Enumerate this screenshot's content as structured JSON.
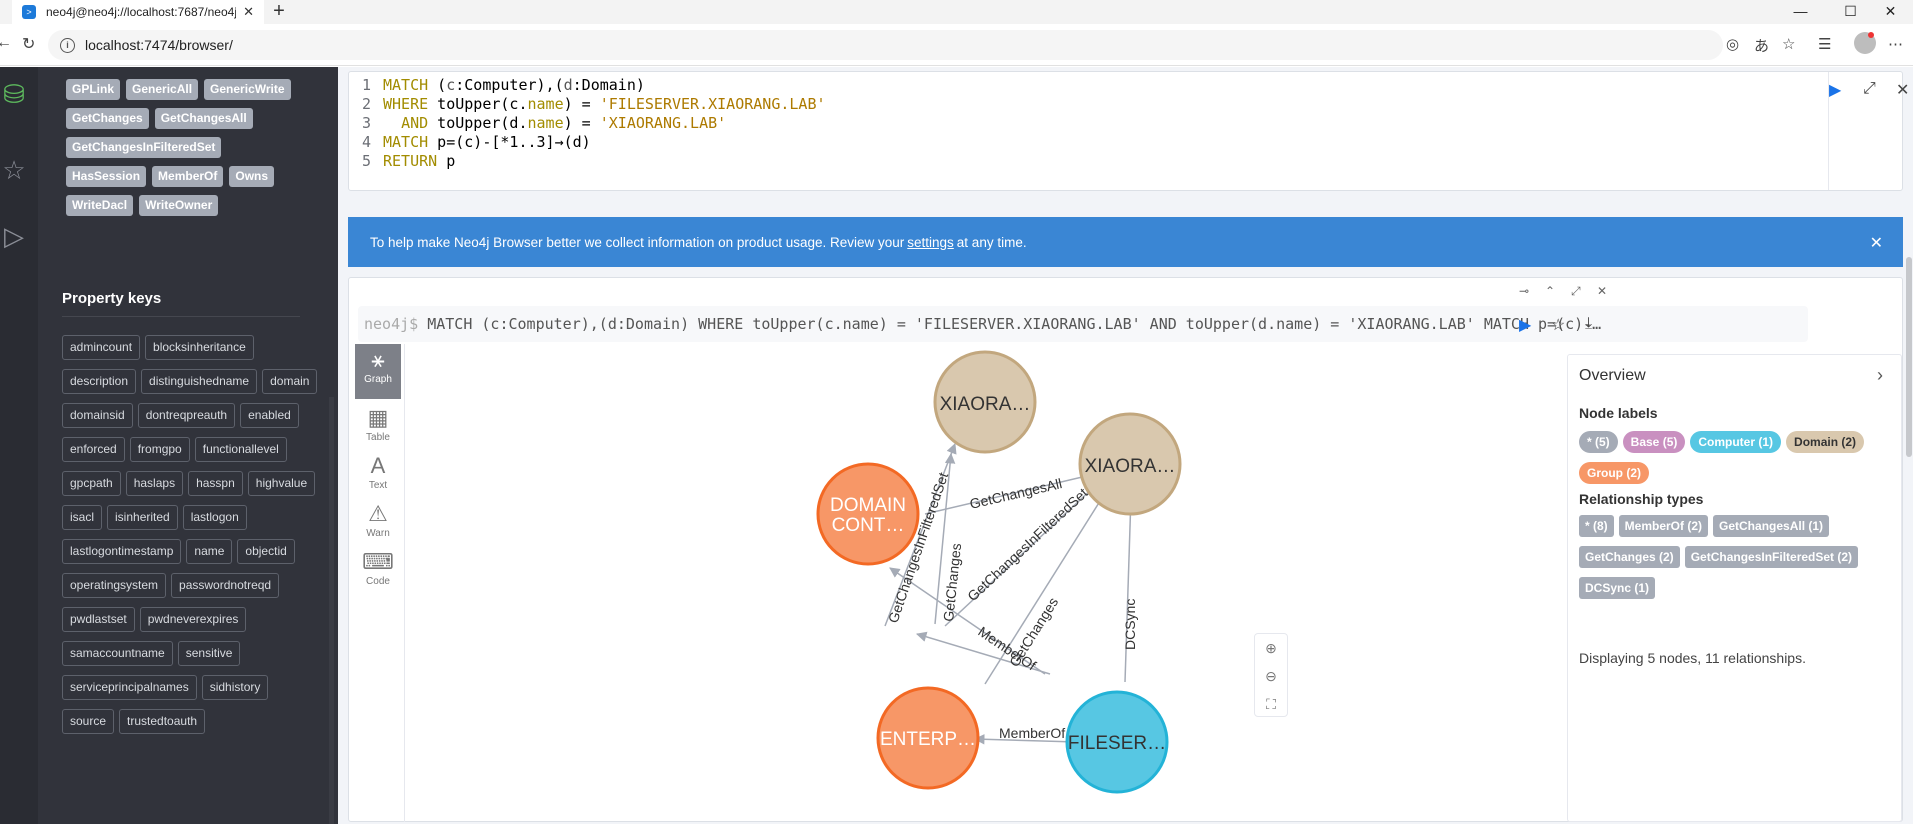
{
  "browser": {
    "tab_title": "neo4j@neo4j://localhost:7687/neo4j",
    "url": "localhost:7474/browser/"
  },
  "drawer": {
    "rel_types": [
      "GPLink",
      "GenericAll",
      "GenericWrite",
      "GetChanges",
      "GetChangesAll",
      "GetChangesInFilteredSet",
      "HasSession",
      "MemberOf",
      "Owns",
      "WriteDacl",
      "WriteOwner"
    ],
    "property_keys_title": "Property keys",
    "property_keys": [
      "admincount",
      "blocksinheritance",
      "description",
      "distinguishedname",
      "domain",
      "domainsid",
      "dontreqpreauth",
      "enabled",
      "enforced",
      "fromgpo",
      "functionallevel",
      "gpcpath",
      "haslaps",
      "hasspn",
      "highvalue",
      "isacl",
      "isinherited",
      "lastlogon",
      "lastlogontimestamp",
      "name",
      "objectid",
      "operatingsystem",
      "passwordnotreqd",
      "pwdlastset",
      "pwdneverexpires",
      "samaccountname",
      "sensitive",
      "serviceprincipalnames",
      "sidhistory",
      "source",
      "trustedtoauth"
    ]
  },
  "editor": {
    "line_numbers": [
      "1",
      "2",
      "3",
      "4",
      "5"
    ]
  },
  "banner": {
    "text_before": "To help make Neo4j Browser better we collect information on product usage. Review your",
    "link": "settings",
    "text_after": "at any time."
  },
  "result": {
    "prompt": "neo4j$",
    "command": "MATCH (c:Computer),(d:Domain) WHERE toUpper(c.name) = 'FILESERVER.XIAORANG.LAB' AND toUpper(d.name) = 'XIAORANG.LAB' MATCH p=(c)-…",
    "views": [
      {
        "label": "Graph",
        "icon": "graph-icon"
      },
      {
        "label": "Table",
        "icon": "table-icon"
      },
      {
        "label": "Text",
        "icon": "text-icon"
      },
      {
        "label": "Warn",
        "icon": "warning-icon"
      },
      {
        "label": "Code",
        "icon": "code-icon"
      }
    ]
  },
  "graph": {
    "nodes": [
      {
        "label": "XIAORA…",
        "type": "Domain",
        "color": "#d9c8ae"
      },
      {
        "label": "XIAORA…",
        "type": "Domain",
        "color": "#d9c8ae"
      },
      {
        "label": "DOMAIN",
        "label2": "CONT…",
        "type": "Group",
        "color": "#f79767"
      },
      {
        "label": "ENTERP…",
        "type": "Group",
        "color": "#f79767"
      },
      {
        "label": "FILESER…",
        "type": "Computer",
        "color": "#57c7e3"
      }
    ],
    "edges": [
      "GetChangesInFilteredSet",
      "GetChangesAll",
      "GetChanges",
      "GetChangesInFilteredSet",
      "GetChanges",
      "MemberOf",
      "GetChanges",
      "DCSync",
      "MemberOf"
    ]
  },
  "overview": {
    "title": "Overview",
    "node_labels_title": "Node labels",
    "node_labels": [
      {
        "text": "* (5)",
        "color": "#a5abb6"
      },
      {
        "text": "Base (5)",
        "color": "#c990c0"
      },
      {
        "text": "Computer (1)",
        "color": "#57c7e3"
      },
      {
        "text": "Domain (2)",
        "color": "#d9c8ae"
      },
      {
        "text": "Group (2)",
        "color": "#f79767"
      }
    ],
    "rel_types_title": "Relationship types",
    "rel_types": [
      "* (8)",
      "MemberOf (2)",
      "GetChangesAll (1)",
      "GetChanges (2)",
      "GetChangesInFilteredSet (2)",
      "DCSync (1)"
    ],
    "footer": "Displaying 5 nodes, 11 relationships."
  }
}
